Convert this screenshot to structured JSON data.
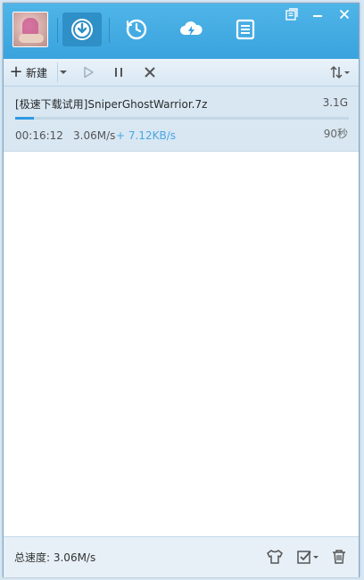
{
  "toolbar": {
    "new_label": "新建"
  },
  "task": {
    "name": "[极速下载试用]SniperGhostWarrior.7z",
    "size": "3.1G",
    "progress": 0.055,
    "elapsed": "00:16:12",
    "speed": "3.06M/s",
    "accel_speed": "+ 7.12KB/s",
    "remaining": "90秒"
  },
  "footer": {
    "total_speed": "总速度: 3.06M/s"
  },
  "colors": {
    "header": "#3aa3dd",
    "progress": "#2e9ae0",
    "accel": "#4aa6e3"
  },
  "icons": {
    "nav": [
      "download-icon",
      "history-icon",
      "cloud-icon",
      "list-icon"
    ],
    "window": [
      "skin-icon",
      "minimize-icon",
      "close-icon"
    ],
    "toolbar": [
      "plus-icon",
      "play-icon",
      "pause-icon",
      "delete-icon",
      "sort-icon"
    ],
    "footer": [
      "shirt-icon",
      "check-icon",
      "trash-icon"
    ]
  }
}
